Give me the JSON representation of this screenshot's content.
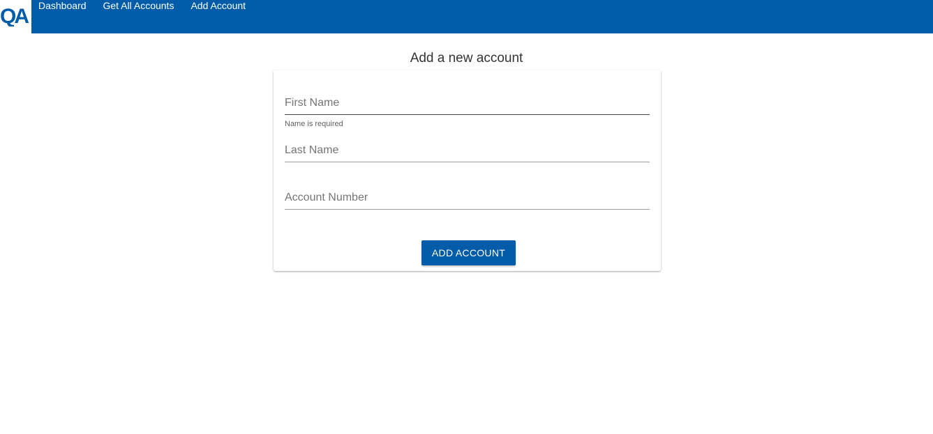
{
  "header": {
    "logo_text": "QA",
    "nav": [
      {
        "label": "Dashboard"
      },
      {
        "label": "Get All Accounts"
      },
      {
        "label": "Add Account"
      }
    ]
  },
  "page": {
    "title": "Add a new account"
  },
  "form": {
    "first_name": {
      "label": "First Name",
      "value": "",
      "helper": "Name is required"
    },
    "last_name": {
      "label": "Last Name",
      "value": ""
    },
    "account_number": {
      "label": "Account Number",
      "value": ""
    },
    "submit_label": "ADD ACCOUNT"
  },
  "colors": {
    "brand": "#005ca9"
  }
}
